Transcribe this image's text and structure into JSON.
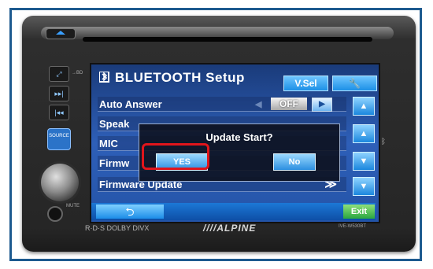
{
  "header": {
    "title": "BLUETOOTH Setup",
    "vsel_label": "V.Sel",
    "tool_icon": "wrench-icon"
  },
  "settings": {
    "rows": [
      {
        "label": "Auto Answer",
        "value": "OFF"
      },
      {
        "label": "Speak"
      },
      {
        "label": "MIC"
      },
      {
        "label": "Firmw"
      },
      {
        "label": "Firmware Update",
        "chevron": "≫"
      }
    ]
  },
  "dialog": {
    "title": "Update Start?",
    "yes_label": "YES",
    "no_label": "No"
  },
  "bottom": {
    "exit_label": "Exit"
  },
  "hardware": {
    "brands": "R·D·S  DOLBY  DIVX",
    "logo": "////ALPINE",
    "model": "IVE-W530BT",
    "source_label": "SOURCE",
    "mute_label": "MUTE"
  },
  "colors": {
    "screen": "#2e5fb8",
    "accent": "#1c8fe6",
    "highlight": "#e0151b",
    "exit": "#2aa640"
  }
}
